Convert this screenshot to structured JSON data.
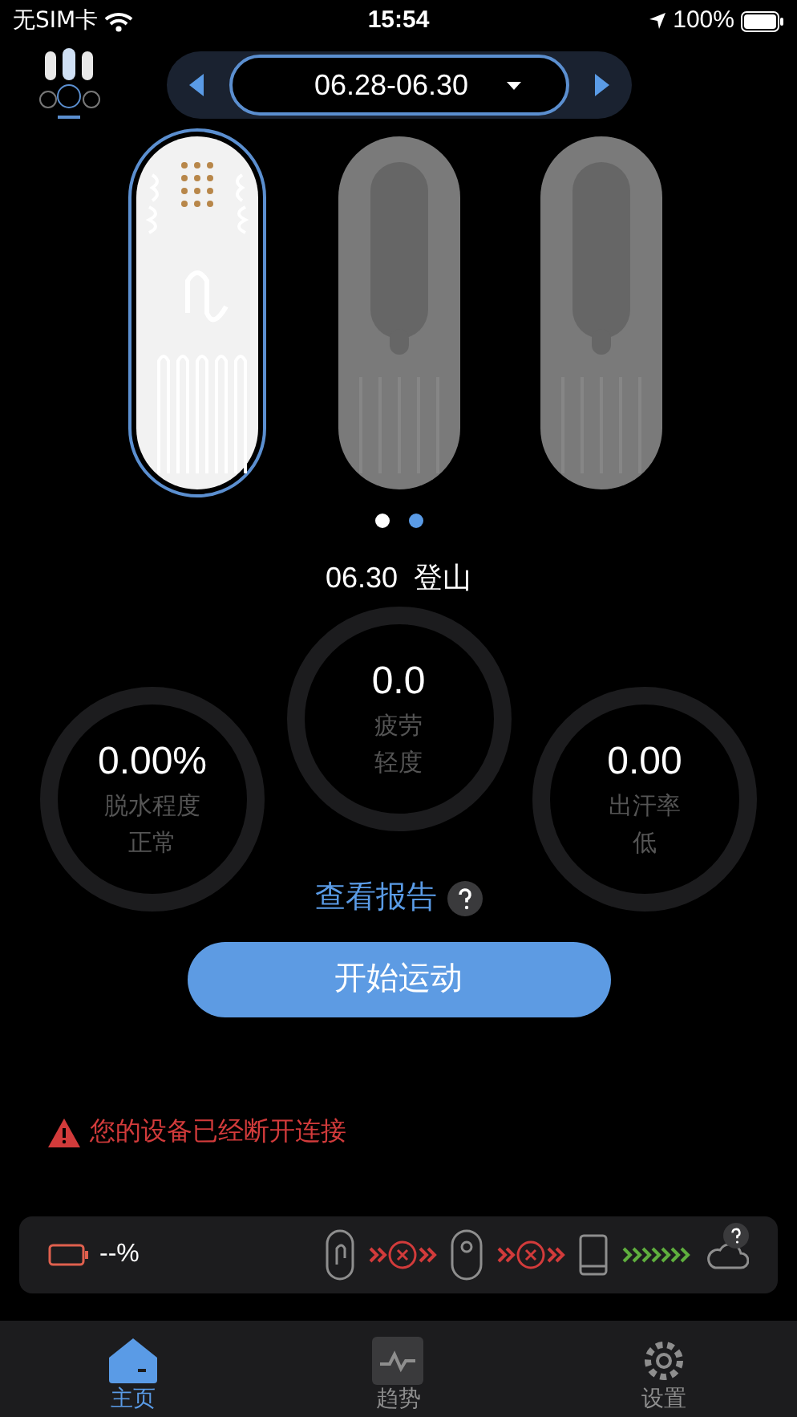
{
  "status_bar": {
    "carrier": "无SIM卡",
    "time": "15:54",
    "battery": "100%"
  },
  "header": {
    "date_range": "06.28-06.30"
  },
  "patches": [
    {
      "selected": true
    },
    {
      "selected": false
    },
    {
      "selected": false
    }
  ],
  "page_dots": [
    {
      "selected": false
    },
    {
      "selected": true
    }
  ],
  "session": {
    "date": "06.30",
    "activity": "登山"
  },
  "metrics": [
    {
      "value": "0.00%",
      "label": "脱水程度",
      "level_text": "正常"
    },
    {
      "value": "0.0",
      "label": "疲劳",
      "level_text": "轻度"
    },
    {
      "value": "0.00",
      "label": "出汗率",
      "level_text": "低"
    }
  ],
  "report_link": "查看报告",
  "start_button": "开始运动",
  "alert": "您的设备已经断开连接",
  "device_bar": {
    "battery_reading": "--%",
    "links": [
      {
        "connected": false
      },
      {
        "connected": false
      },
      {
        "connected": true
      }
    ]
  },
  "tabs": [
    {
      "label": "主页",
      "selected": true
    },
    {
      "label": "趋势",
      "selected": false
    },
    {
      "label": "设置",
      "selected": false
    }
  ]
}
